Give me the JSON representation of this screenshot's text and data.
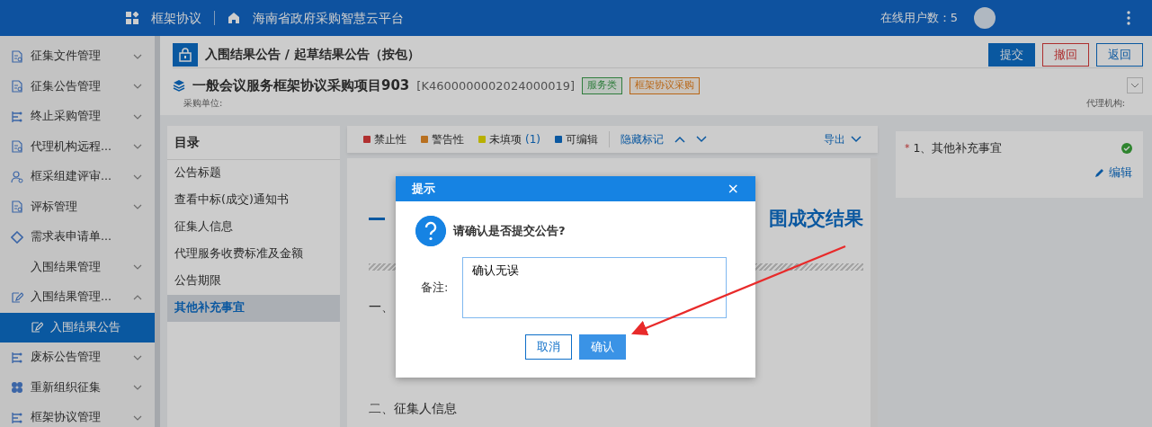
{
  "header": {
    "module": "框架协议",
    "platform": "海南省政府采购智慧云平台",
    "online_users": "在线用户数：5"
  },
  "sidebar": {
    "items": [
      {
        "label": "征集文件管理",
        "kind": "doc",
        "expanded": false
      },
      {
        "label": "征集公告管理",
        "kind": "doc",
        "expanded": false
      },
      {
        "label": "终止采购管理",
        "kind": "flow",
        "expanded": false
      },
      {
        "label": "代理机构远程...",
        "kind": "doc",
        "expanded": false
      },
      {
        "label": "框采组建评审...",
        "kind": "person",
        "expanded": false
      },
      {
        "label": "评标管理",
        "kind": "doc",
        "expanded": false
      },
      {
        "label": "需求表申请单...",
        "kind": "diamond"
      },
      {
        "label": "入围结果管理",
        "kind": "plain",
        "expanded": false
      },
      {
        "label": "入围结果管理...",
        "kind": "edit",
        "expanded": true,
        "children": [
          {
            "label": "入围结果公告",
            "kind": "edit",
            "selected": true
          }
        ]
      },
      {
        "label": "废标公告管理",
        "kind": "flow",
        "expanded": false
      },
      {
        "label": "重新组织征集",
        "kind": "grid",
        "expanded": false
      },
      {
        "label": "框架协议管理",
        "kind": "flow",
        "expanded": false
      }
    ]
  },
  "page": {
    "title": "入围结果公告 / 起草结果公告（按包）",
    "buttons": [
      {
        "label": "提交",
        "kind": "primary"
      },
      {
        "label": "撤回",
        "kind": "danger"
      },
      {
        "label": "返回",
        "kind": "outline"
      }
    ],
    "project": {
      "name": "一般会议服务框架协议采购项目903",
      "code": "[K4600000002024000019]",
      "tags": [
        {
          "label": "服务类",
          "color": "#2f7d3c"
        },
        {
          "label": "框架协议采购",
          "color": "#b86616"
        }
      ],
      "purchaser_label": "采购单位:",
      "agency_label": "代理机构:"
    }
  },
  "toc": {
    "title": "目录",
    "items": [
      {
        "label": "公告标题",
        "selected": false
      },
      {
        "label": "查看中标(成交)通知书",
        "selected": false
      },
      {
        "label": "征集人信息",
        "selected": false
      },
      {
        "label": "代理服务收费标准及金额",
        "selected": false
      },
      {
        "label": "公告期限",
        "selected": false
      },
      {
        "label": "其他补充事宜",
        "selected": true
      }
    ]
  },
  "toolbar": {
    "legend": [
      {
        "label": "禁止性",
        "color": "#b03030"
      },
      {
        "label": "警告性",
        "color": "#b87020"
      },
      {
        "label": "未填项",
        "count": "(1)",
        "color": "#b8b000"
      },
      {
        "label": "可编辑",
        "color": "#0a58a0"
      }
    ],
    "hide_marks": "隐藏标记",
    "export": "导出"
  },
  "document": {
    "title_visible": "围成交结果",
    "section_1": "一、",
    "section_2": "二、征集人信息"
  },
  "right_panel": {
    "items": [
      {
        "required_mark": "*",
        "label": "1、其他补充事宜",
        "done": true,
        "action": "编辑"
      }
    ]
  },
  "dialog": {
    "title": "提示",
    "close": "×",
    "message": "请确认是否提交公告?",
    "remark_label": "备注:",
    "remark_value": "确认无误",
    "buttons": [
      {
        "label": "取消",
        "kind": "outline"
      },
      {
        "label": "确认",
        "kind": "primary"
      }
    ]
  }
}
